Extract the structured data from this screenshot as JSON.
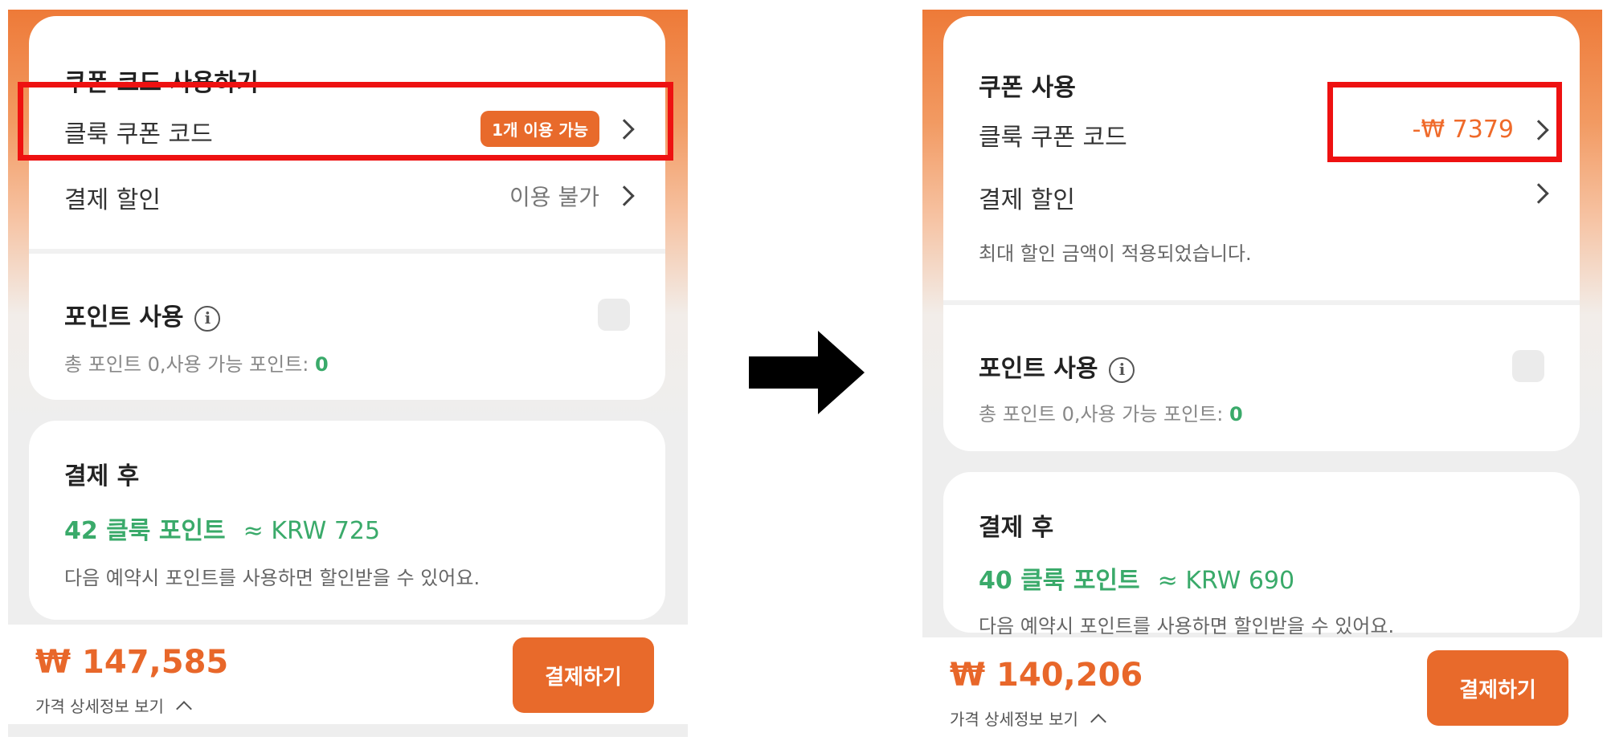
{
  "colors": {
    "accent": "#e86a2b",
    "highlight": "#ee1111",
    "points_green": "#3aaa6a",
    "discount_orange": "#ef6a2a"
  },
  "icons": {
    "flow_arrow": "right-arrow-icon",
    "chevron": "chevron-right-icon",
    "info": "info-icon"
  },
  "before": {
    "coupon_section": {
      "title": "쿠폰 코드 사용하기",
      "klook_coupon_label": "클룩 쿠폰 코드",
      "klook_coupon_badge": "1개 이용 가능",
      "payment_discount_label": "결제 할인",
      "payment_discount_value": "이용 불가"
    },
    "points_section": {
      "title": "포인트 사용",
      "info_glyph": "i",
      "total_prefix": "총 포인트 0,사용 가능 포인트: ",
      "available": "0"
    },
    "after_payment": {
      "title": "결제 후",
      "earn_points": "42 클룩 포인트",
      "earn_krw": "≈ KRW 725",
      "note": "다음 예약시 포인트를 사용하면 할인받을 수 있어요."
    },
    "footer": {
      "total": "₩ 147,585",
      "details_link": "가격 상세정보 보기",
      "pay_button": "결제하기"
    }
  },
  "after": {
    "coupon_section": {
      "title": "쿠폰 사용",
      "klook_coupon_label": "클룩 쿠폰 코드",
      "klook_coupon_discount": "-₩ 7379",
      "payment_discount_label": "결제 할인",
      "max_discount_note": "최대 할인 금액이 적용되었습니다."
    },
    "points_section": {
      "title": "포인트 사용",
      "info_glyph": "i",
      "total_prefix": "총 포인트 0,사용 가능 포인트: ",
      "available": "0"
    },
    "after_payment": {
      "title": "결제 후",
      "earn_points": "40 클룩 포인트",
      "earn_krw": "≈ KRW 690",
      "note": "다음 예약시 포인트를 사용하면 할인받을 수 있어요."
    },
    "footer": {
      "total": "₩ 140,206",
      "details_link": "가격 상세정보 보기",
      "pay_button": "결제하기"
    }
  }
}
